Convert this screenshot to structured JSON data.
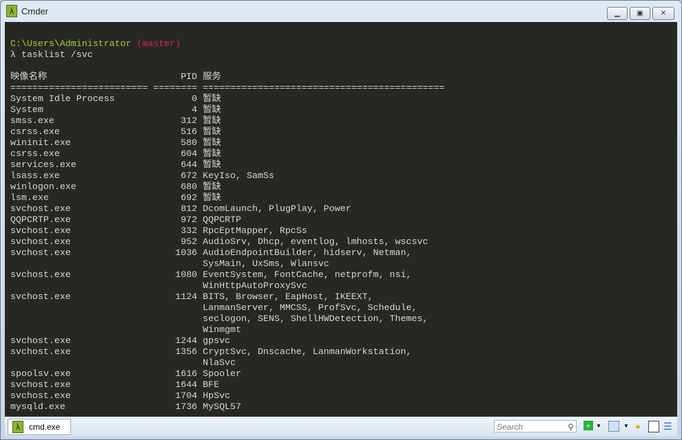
{
  "window": {
    "title": "Cmder",
    "controls": [
      "minimize",
      "maximize",
      "close"
    ]
  },
  "prompt": {
    "path": "C:\\Users\\Administrator",
    "branch": "(master)",
    "symbol": "λ",
    "command": "tasklist /svc"
  },
  "table": {
    "headers": [
      "映像名称",
      "PID",
      "服务"
    ],
    "separator": [
      "=========================",
      "========",
      "============================================"
    ],
    "rows": [
      {
        "name": "System Idle Process",
        "pid": "0",
        "services": [
          "暂缺"
        ]
      },
      {
        "name": "System",
        "pid": "4",
        "services": [
          "暂缺"
        ]
      },
      {
        "name": "smss.exe",
        "pid": "312",
        "services": [
          "暂缺"
        ]
      },
      {
        "name": "csrss.exe",
        "pid": "516",
        "services": [
          "暂缺"
        ]
      },
      {
        "name": "wininit.exe",
        "pid": "580",
        "services": [
          "暂缺"
        ]
      },
      {
        "name": "csrss.exe",
        "pid": "604",
        "services": [
          "暂缺"
        ]
      },
      {
        "name": "services.exe",
        "pid": "644",
        "services": [
          "暂缺"
        ]
      },
      {
        "name": "lsass.exe",
        "pid": "672",
        "services": [
          "KeyIso, SamSs"
        ]
      },
      {
        "name": "winlogon.exe",
        "pid": "680",
        "services": [
          "暂缺"
        ]
      },
      {
        "name": "lsm.exe",
        "pid": "692",
        "services": [
          "暂缺"
        ]
      },
      {
        "name": "svchost.exe",
        "pid": "812",
        "services": [
          "DcomLaunch, PlugPlay, Power"
        ]
      },
      {
        "name": "QQPCRTP.exe",
        "pid": "972",
        "services": [
          "QQPCRTP"
        ]
      },
      {
        "name": "svchost.exe",
        "pid": "332",
        "services": [
          "RpcEptMapper, RpcSs"
        ]
      },
      {
        "name": "svchost.exe",
        "pid": "952",
        "services": [
          "AudioSrv, Dhcp, eventlog, lmhosts, wscsvc"
        ]
      },
      {
        "name": "svchost.exe",
        "pid": "1036",
        "services": [
          "AudioEndpointBuilder, hidserv, Netman,",
          "SysMain, UxSms, Wlansvc"
        ]
      },
      {
        "name": "svchost.exe",
        "pid": "1080",
        "services": [
          "EventSystem, FontCache, netprofm, nsi,",
          "WinHttpAutoProxySvc"
        ]
      },
      {
        "name": "svchost.exe",
        "pid": "1124",
        "services": [
          "BITS, Browser, EapHost, IKEEXT,",
          "LanmanServer, MMCSS, ProfSvc, Schedule,",
          "seclogon, SENS, ShellHWDetection, Themes,",
          "Winmgmt"
        ]
      },
      {
        "name": "svchost.exe",
        "pid": "1244",
        "services": [
          "gpsvc"
        ]
      },
      {
        "name": "svchost.exe",
        "pid": "1356",
        "services": [
          "CryptSvc, Dnscache, LanmanWorkstation,",
          "NlaSvc"
        ]
      },
      {
        "name": "spoolsv.exe",
        "pid": "1616",
        "services": [
          "Spooler"
        ]
      },
      {
        "name": "svchost.exe",
        "pid": "1644",
        "services": [
          "BFE"
        ]
      },
      {
        "name": "svchost.exe",
        "pid": "1704",
        "services": [
          "HpSvc"
        ]
      },
      {
        "name": "mysqld.exe",
        "pid": "1736",
        "services": [
          "MySQL57"
        ]
      }
    ]
  },
  "statusbar": {
    "tab_label": "cmd.exe",
    "search_placeholder": "Search",
    "icons": [
      "search-icon",
      "new-console-icon",
      "dropdown-icon",
      "console-list-icon",
      "dropdown-icon",
      "lock-icon",
      "split-icon",
      "menu-icon"
    ]
  },
  "colors": {
    "terminal_bg": "#272822",
    "path": "#a6c93a",
    "branch": "#d6235b",
    "text": "#d8d8d2"
  }
}
